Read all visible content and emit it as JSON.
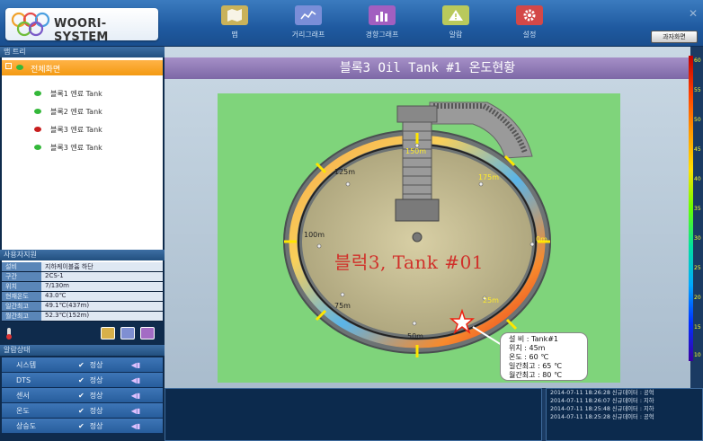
{
  "header": {
    "brand": "WOORI-SYSTEM",
    "nav": [
      {
        "label": "맵",
        "icon": "map-icon",
        "color": "#c9b25a"
      },
      {
        "label": "거리그래프",
        "icon": "line-chart-icon",
        "color": "#7a8ed8"
      },
      {
        "label": "경향그래프",
        "icon": "bar-chart-icon",
        "color": "#a25fc0"
      },
      {
        "label": "알람",
        "icon": "warning-icon",
        "color": "#b9c95c"
      },
      {
        "label": "설정",
        "icon": "gear-icon",
        "color": "#d34848"
      }
    ],
    "exit_label": "과자화면"
  },
  "tree": {
    "title": "맵 트리",
    "root": "전체화면",
    "items": [
      {
        "label": "블록1 엔료 Tank",
        "status": "#34b83a"
      },
      {
        "label": "블록2 엔료 Tank",
        "status": "#34b83a"
      },
      {
        "label": "블록3 엔료 Tank",
        "status": "#c81e1e"
      },
      {
        "label": "블록3 엔료 Tank",
        "status": "#34b83a"
      }
    ]
  },
  "facility": {
    "title": "사용자지원",
    "rows": [
      {
        "k": "설비",
        "v": "지하케이블흄 하단"
      },
      {
        "k": "구간",
        "v": "2CS-1"
      },
      {
        "k": "위치",
        "v": "7/130m"
      },
      {
        "k": "현재온도",
        "v": "43.0℃"
      },
      {
        "k": "일간최고",
        "v": "49.1℃(437m)"
      },
      {
        "k": "월간최고",
        "v": "52.3℃(152m)"
      }
    ]
  },
  "alarm": {
    "title": "알람상태",
    "rows": [
      {
        "name": "시스템",
        "status": "정상",
        "icon": "monitor-icon"
      },
      {
        "name": "DTS",
        "status": "정상",
        "icon": "device-icon"
      },
      {
        "name": "센서",
        "status": "정상",
        "icon": "sensor-icon"
      },
      {
        "name": "온도",
        "status": "정상",
        "icon": "thermometer-icon"
      },
      {
        "name": "상승도",
        "status": "정상",
        "icon": "rise-icon"
      }
    ]
  },
  "main": {
    "title": "블록3 Oil Tank #1 온도현황",
    "tank_label": "블럭3, Tank #01",
    "markers": [
      "150m",
      "175m",
      "0m",
      "25m",
      "50m",
      "75m",
      "100m",
      "125m"
    ],
    "info": {
      "line1": "설 비 : Tank#1",
      "line2": "위치 : 45m",
      "line3": "온도 : 60 ℃",
      "line4": "일간최고 : 65 ℃",
      "line5": "월간최고 : 80 ℃"
    }
  },
  "scale": {
    "ticks": [
      "60",
      "55",
      "50",
      "45",
      "40",
      "35",
      "30",
      "25",
      "20",
      "15",
      "10"
    ]
  },
  "log": {
    "lines": [
      "2014-07-11 18:26:28 신규데이터 : 공혁",
      "2014-07-11 18:26:07 신규데이터 : 지하",
      "2014-07-11 18:25:48 신규데이터 : 지하",
      "2014-07-11 18:25:28 신규데이터 : 공혁"
    ]
  }
}
